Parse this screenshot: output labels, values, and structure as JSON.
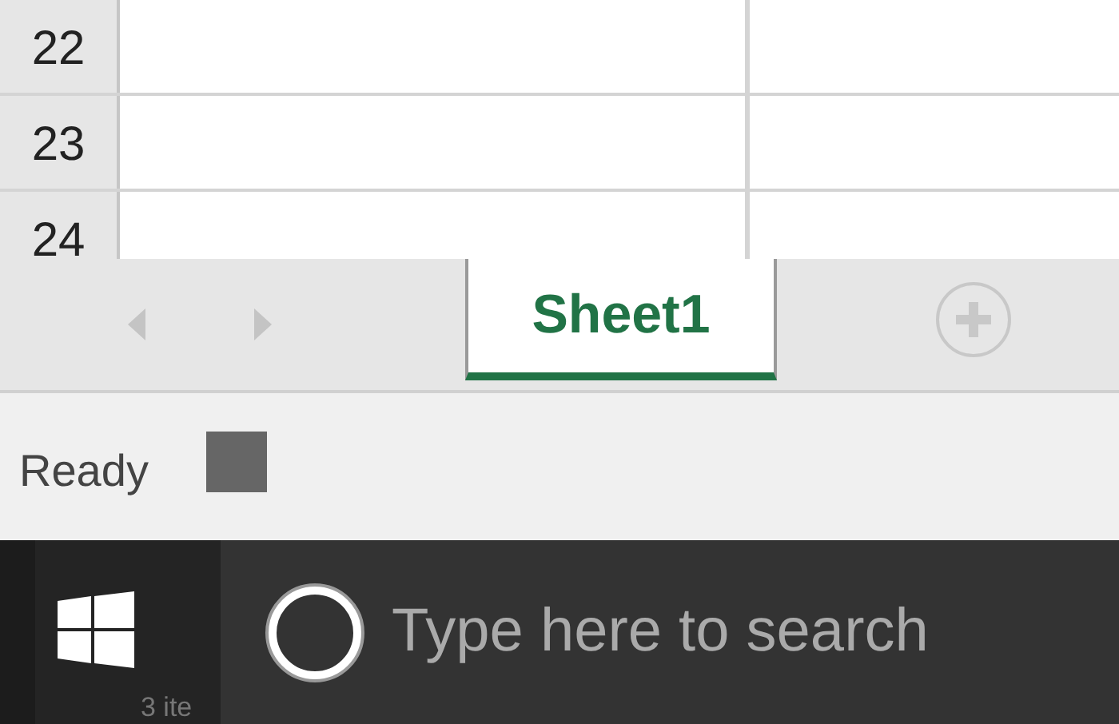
{
  "grid": {
    "rows": [
      {
        "header": "22"
      },
      {
        "header": "23"
      },
      {
        "header": "24"
      }
    ]
  },
  "sheet_tabs": [
    {
      "label": "Sheet1",
      "selected": true
    }
  ],
  "status_bar": {
    "text": "Ready"
  },
  "taskbar": {
    "background_text": "3 ite",
    "search": {
      "placeholder": "Type here to search"
    }
  }
}
